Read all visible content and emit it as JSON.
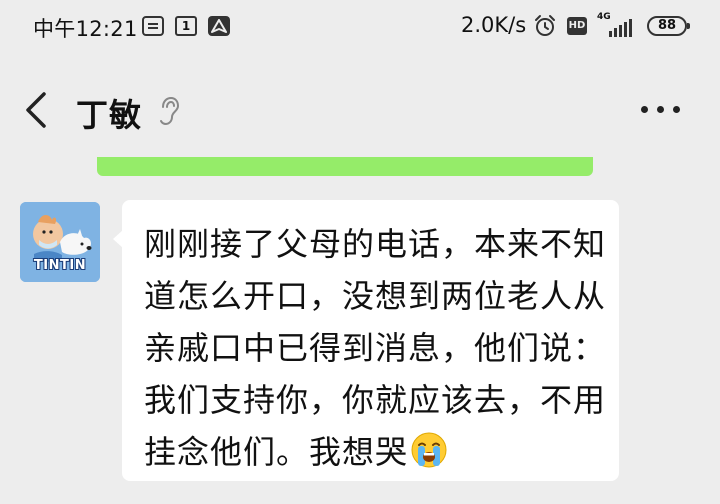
{
  "status_bar": {
    "time": "中午12:21",
    "calendar_day": "1",
    "network_speed": "2.0K/s",
    "hd_label": "HD",
    "signal_type": "4G",
    "battery_level": "88",
    "icons": [
      "message-icon",
      "calendar-icon",
      "navigation-icon",
      "alarm-icon",
      "hd-icon",
      "signal-icon",
      "battery-icon"
    ]
  },
  "header": {
    "title": "丁敏",
    "back_icon": "chevron-left-icon",
    "mode_icon": "ear-icon",
    "more_icon": "more-dots-icon"
  },
  "message": {
    "avatar_label": "TINTIN",
    "lines": [
      "刚刚接了父母的电话，本来不知",
      "道怎么开口，没想到两位老人从",
      "亲戚口中已得到消息，他们说：",
      "我们支持你，你就应该去，不用",
      "挂念他们。我想哭"
    ],
    "emoji": "crying-face-emoji"
  },
  "colors": {
    "background": "#ededed",
    "bubble_incoming": "#ffffff",
    "bubble_outgoing": "#95ec69",
    "text": "#111111"
  }
}
